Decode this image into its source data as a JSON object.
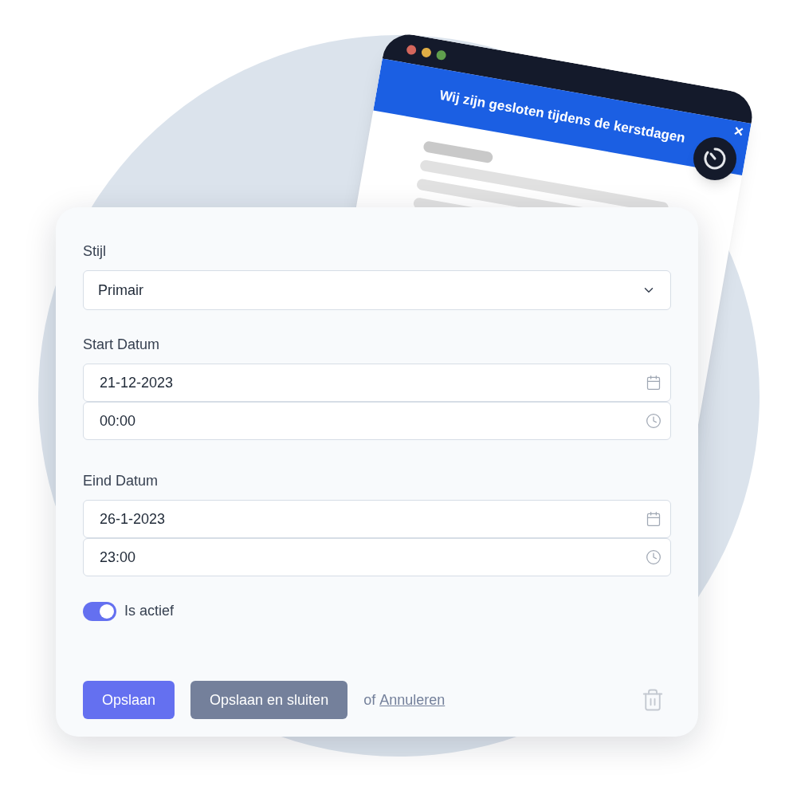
{
  "banner": {
    "message": "Wij zijn gesloten tijdens de kerstdagen",
    "close": "×"
  },
  "form": {
    "style": {
      "label": "Stijl",
      "value": "Primair"
    },
    "start": {
      "label": "Start Datum",
      "date": "21-12-2023",
      "time": "00:00"
    },
    "end": {
      "label": "Eind Datum",
      "date": "26-1-2023",
      "time": "23:00"
    },
    "active": {
      "label": "Is actief",
      "on": true
    },
    "buttons": [
      {
        "label": "Opslaan",
        "kind": "primary"
      },
      {
        "label": "Opslaan en sluiten",
        "kind": "secondary"
      }
    ],
    "cancel": {
      "prefix": "of",
      "link": "Annuleren"
    }
  }
}
